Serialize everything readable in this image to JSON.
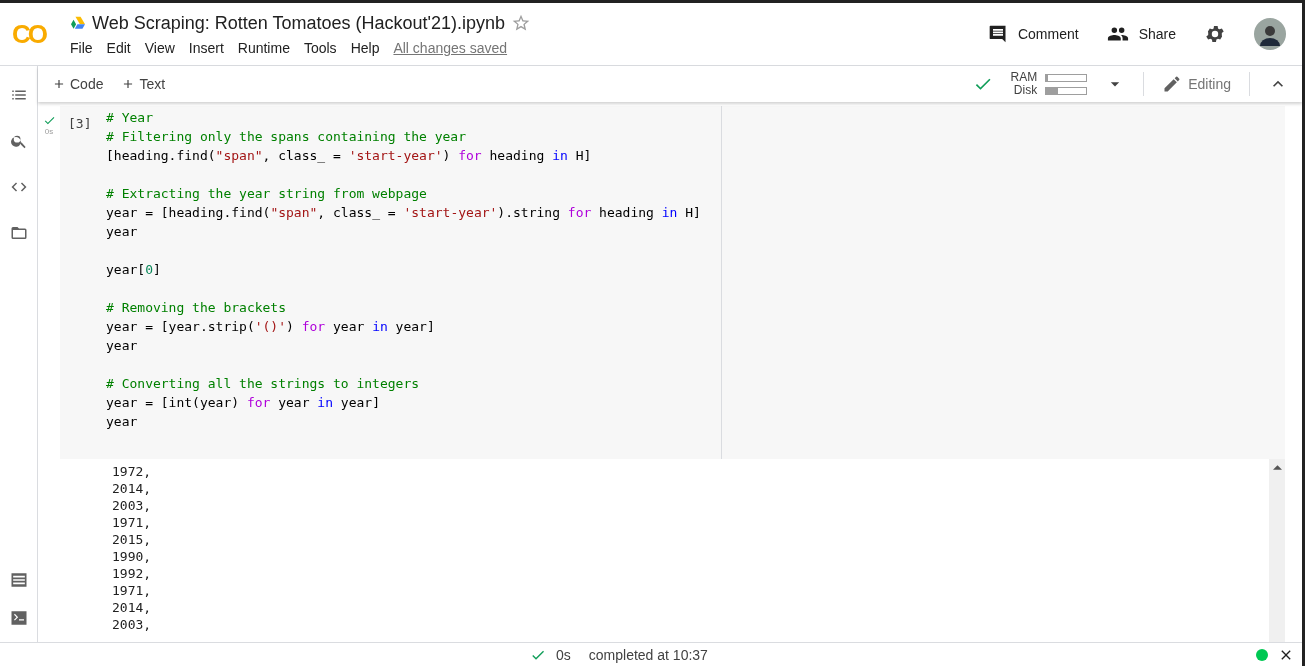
{
  "header": {
    "logo": "CO",
    "title": "Web Scraping: Rotten Tomatoes (Hackout'21).ipynb",
    "starred": false,
    "menu": [
      "File",
      "Edit",
      "View",
      "Insert",
      "Runtime",
      "Tools",
      "Help"
    ],
    "save_status": "All changes saved",
    "actions": [
      {
        "kind": "comment",
        "label": "Comment"
      },
      {
        "kind": "share",
        "label": "Share"
      }
    ]
  },
  "toolbar": {
    "add": [
      {
        "label": "Code"
      },
      {
        "label": "Text"
      }
    ],
    "resources": [
      {
        "label": "RAM",
        "level": 0.05
      },
      {
        "label": "Disk",
        "level": 0.3
      }
    ],
    "mode": "Editing"
  },
  "cell": {
    "run_count": "[3]",
    "duration": "0s",
    "lines": [
      {
        "kind": "code",
        "tokens": [
          {
            "text": "# Year",
            "kind": "comment"
          }
        ]
      },
      {
        "kind": "code",
        "tokens": [
          {
            "text": "# Filtering only the spans containing the year",
            "kind": "comment"
          }
        ]
      },
      {
        "kind": "code",
        "tokens": [
          {
            "text": "[heading.find(",
            "kind": "plain"
          },
          {
            "text": "\"span\"",
            "kind": "string"
          },
          {
            "text": ", class_ = ",
            "kind": "plain"
          },
          {
            "text": "'start-year'",
            "kind": "string"
          },
          {
            "text": ") ",
            "kind": "plain"
          },
          {
            "text": "for",
            "kind": "keyword"
          },
          {
            "text": " heading ",
            "kind": "plain"
          },
          {
            "text": "in",
            "kind": "operator"
          },
          {
            "text": " H]",
            "kind": "plain"
          }
        ]
      },
      {
        "kind": "blank"
      },
      {
        "kind": "code",
        "tokens": [
          {
            "text": "# Extracting the year string from webpage",
            "kind": "comment"
          }
        ]
      },
      {
        "kind": "code",
        "tokens": [
          {
            "text": "year = [heading.find(",
            "kind": "plain"
          },
          {
            "text": "\"span\"",
            "kind": "string"
          },
          {
            "text": ", class_ = ",
            "kind": "plain"
          },
          {
            "text": "'start-year'",
            "kind": "string"
          },
          {
            "text": ").string ",
            "kind": "plain"
          },
          {
            "text": "for",
            "kind": "keyword"
          },
          {
            "text": " heading ",
            "kind": "plain"
          },
          {
            "text": "in",
            "kind": "operator"
          },
          {
            "text": " H]",
            "kind": "plain"
          }
        ]
      },
      {
        "kind": "code",
        "tokens": [
          {
            "text": "year",
            "kind": "plain"
          }
        ]
      },
      {
        "kind": "blank"
      },
      {
        "kind": "code",
        "tokens": [
          {
            "text": "year[",
            "kind": "plain"
          },
          {
            "text": "0",
            "kind": "number"
          },
          {
            "text": "]",
            "kind": "plain"
          }
        ]
      },
      {
        "kind": "blank"
      },
      {
        "kind": "code",
        "tokens": [
          {
            "text": "# Removing the brackets",
            "kind": "comment"
          }
        ]
      },
      {
        "kind": "code",
        "tokens": [
          {
            "text": "year = [year.strip(",
            "kind": "plain"
          },
          {
            "text": "'()'",
            "kind": "string"
          },
          {
            "text": ") ",
            "kind": "plain"
          },
          {
            "text": "for",
            "kind": "keyword"
          },
          {
            "text": " year ",
            "kind": "plain"
          },
          {
            "text": "in",
            "kind": "operator"
          },
          {
            "text": " year]",
            "kind": "plain"
          }
        ]
      },
      {
        "kind": "code",
        "tokens": [
          {
            "text": "year",
            "kind": "plain"
          }
        ]
      },
      {
        "kind": "blank"
      },
      {
        "kind": "code",
        "tokens": [
          {
            "text": "# Converting all the strings to integers",
            "kind": "comment"
          }
        ]
      },
      {
        "kind": "code",
        "tokens": [
          {
            "text": "year = [int(year) ",
            "kind": "plain"
          },
          {
            "text": "for",
            "kind": "keyword"
          },
          {
            "text": " year ",
            "kind": "plain"
          },
          {
            "text": "in",
            "kind": "operator"
          },
          {
            "text": " year]",
            "kind": "plain"
          }
        ]
      },
      {
        "kind": "code",
        "tokens": [
          {
            "text": "year",
            "kind": "plain"
          }
        ]
      }
    ],
    "output": [
      "1972,",
      "2014,",
      "2003,",
      "1971,",
      "2015,",
      "1990,",
      "1992,",
      "1971,",
      "2014,",
      "2003,"
    ]
  },
  "status_bar": {
    "duration": "0s",
    "message": "completed at 10:37",
    "connected": true
  }
}
